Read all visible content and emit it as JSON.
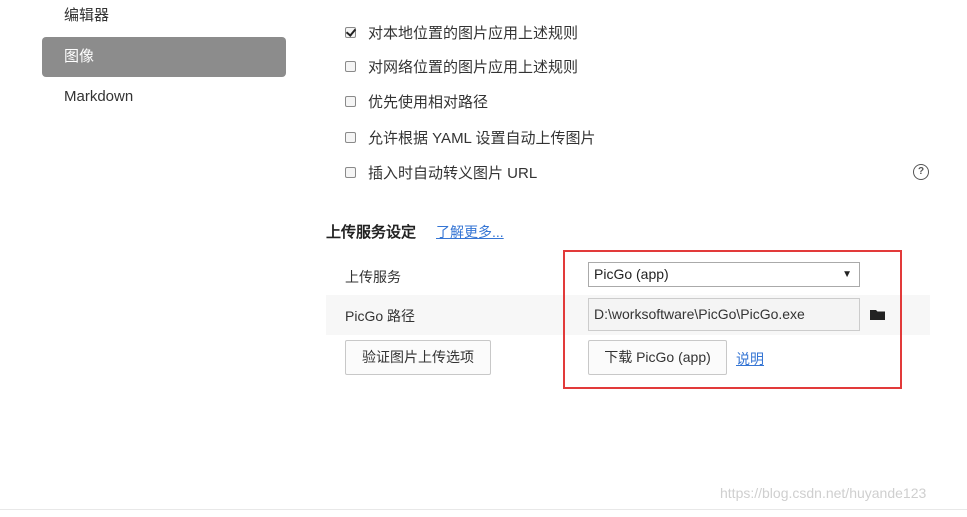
{
  "sidebar": {
    "items": [
      {
        "label": "编辑器",
        "active": false
      },
      {
        "label": "图像",
        "active": true
      },
      {
        "label": "Markdown",
        "active": false
      }
    ]
  },
  "image_rules": {
    "options": [
      {
        "label": "对本地位置的图片应用上述规则",
        "checked": true
      },
      {
        "label": "对网络位置的图片应用上述规则",
        "checked": false
      },
      {
        "label": "优先使用相对路径",
        "checked": false
      },
      {
        "label": "允许根据 YAML 设置自动上传图片",
        "checked": false
      },
      {
        "label": "插入时自动转义图片 URL",
        "checked": false
      }
    ],
    "help_icon": "question-circle-icon",
    "help_glyph": "?"
  },
  "upload": {
    "section_title": "上传服务设定",
    "learn_more": "了解更多...",
    "service_label": "上传服务",
    "service_value": "PicGo (app)",
    "path_label": "PicGo 路径",
    "path_value": "D:\\worksoftware\\PicGo\\PicGo.exe",
    "verify_button": "验证图片上传选项",
    "download_button": "下载 PicGo (app)",
    "help_link": "说明",
    "folder_icon": "folder-icon"
  },
  "watermark": "https://blog.csdn.net/huyande123",
  "colors": {
    "active_sidebar": "#8c8c8c",
    "link": "#3575d4",
    "highlight": "#e23a3a"
  }
}
